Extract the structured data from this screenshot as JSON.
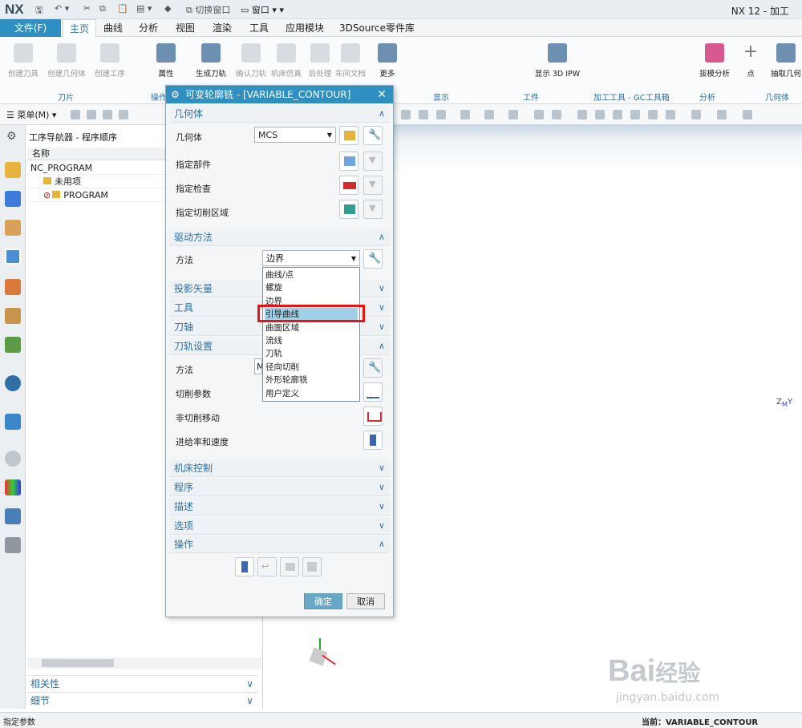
{
  "app": {
    "logo": "NX",
    "title": "NX 12 - 加工",
    "switch_window": "切换窗口",
    "window_menu": "窗口"
  },
  "tabs": [
    "文件(F)",
    "主页",
    "曲线",
    "分析",
    "视图",
    "渲染",
    "工具",
    "应用模块",
    "3DSource零件库"
  ],
  "ribbon": {
    "buttons": [
      "创建刀具",
      "创建几何体",
      "创建工序",
      "属性",
      "生成刀轨",
      "确认刀轨",
      "机床仿真",
      "后处理",
      "车间文档",
      "更多",
      "显示 3D IPW",
      "拔模分析",
      "点",
      "抽取几何"
    ],
    "groups": [
      "刀片",
      "操作",
      "显示",
      "工件",
      "加工工具 - GC工具箱",
      "分析",
      "几何体"
    ]
  },
  "toolbar": {
    "menu": "菜单(M)"
  },
  "navigator": {
    "title": "工序导航器 - 程序顺序",
    "column": "名称",
    "rows": [
      "NC_PROGRAM",
      "未用项",
      "PROGRAM"
    ],
    "footer": [
      "相关性",
      "细节"
    ]
  },
  "dialog": {
    "title": "可变轮廓铣 - [VARIABLE_CONTOUR]",
    "sections": {
      "geometry": "几何体",
      "drive": "驱动方法",
      "projection": "投影矢量",
      "tool": "工具",
      "axis": "刀轴",
      "path": "刀轨设置",
      "machine": "机床控制",
      "program": "程序",
      "desc": "描述",
      "options": "选项",
      "actions": "操作"
    },
    "geometry_label": "几何体",
    "geometry_value": "MCS",
    "part_label": "指定部件",
    "check_label": "指定检查",
    "area_label": "指定切削区域",
    "method_label": "方法",
    "method_value": "边界",
    "dropdown": [
      "曲线/点",
      "螺旋",
      "边界",
      "引导曲线",
      "曲面区域",
      "流线",
      "刀轨",
      "径向切削",
      "外形轮廓铣",
      "用户定义"
    ],
    "path_method_label": "方法",
    "path_method_value": "M",
    "cut_params": "切削参数",
    "non_cut": "非切削移动",
    "feeds": "进给率和速度",
    "ok": "确定",
    "cancel": "取消"
  },
  "status": {
    "left": "指定参数",
    "right": "当前：VARIABLE_CONTOUR"
  },
  "watermark": {
    "brand": "Bai",
    "suffix": "经验",
    "url": "jingyan.baidu.com"
  },
  "colors": {
    "accent": "#2f8fc0",
    "highlight": "#e11111"
  }
}
